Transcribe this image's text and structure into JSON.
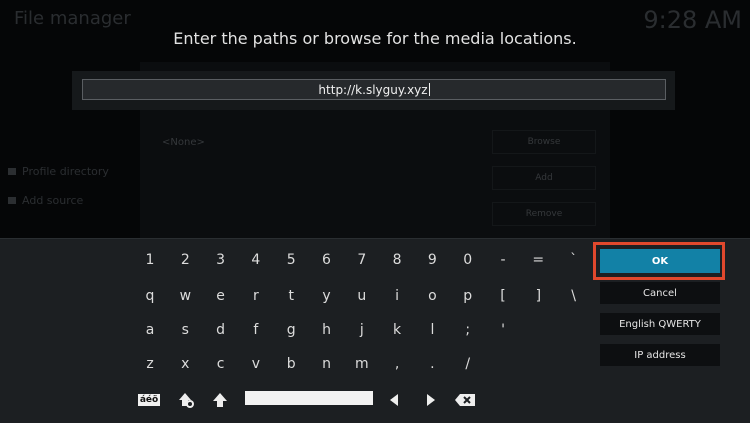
{
  "background": {
    "title": "File manager",
    "clock": "9:28 AM",
    "side_items": [
      "Profile directory",
      "Add source"
    ],
    "none_label": "<None>",
    "panel_buttons": [
      "Browse",
      "Add",
      "Remove"
    ]
  },
  "dialog": {
    "heading": "Enter the paths or browse for the media locations.",
    "input_value": "http://k.slyguy.xyz"
  },
  "keyboard": {
    "row1": [
      "1",
      "2",
      "3",
      "4",
      "5",
      "6",
      "7",
      "8",
      "9",
      "0",
      "-",
      "=",
      "`"
    ],
    "row2": [
      "q",
      "w",
      "e",
      "r",
      "t",
      "y",
      "u",
      "i",
      "o",
      "p",
      "[",
      "]",
      "\\"
    ],
    "row3": [
      "a",
      "s",
      "d",
      "f",
      "g",
      "h",
      "j",
      "k",
      "l",
      ";",
      "'"
    ],
    "row4": [
      "z",
      "x",
      "c",
      "v",
      "b",
      "n",
      "m",
      ",",
      ".",
      "/"
    ],
    "special_keys": {
      "accents": "áéö",
      "icons": [
        "accent-icon",
        "shift-lock-icon",
        "shift-icon",
        "space-bar",
        "arrow-left-icon",
        "arrow-right-icon",
        "backspace-icon"
      ]
    }
  },
  "buttons": {
    "ok": "OK",
    "cancel": "Cancel",
    "layout": "English QWERTY",
    "ip": "IP address"
  },
  "colors": {
    "accent": "#1281a6",
    "highlight": "#e0482d"
  }
}
